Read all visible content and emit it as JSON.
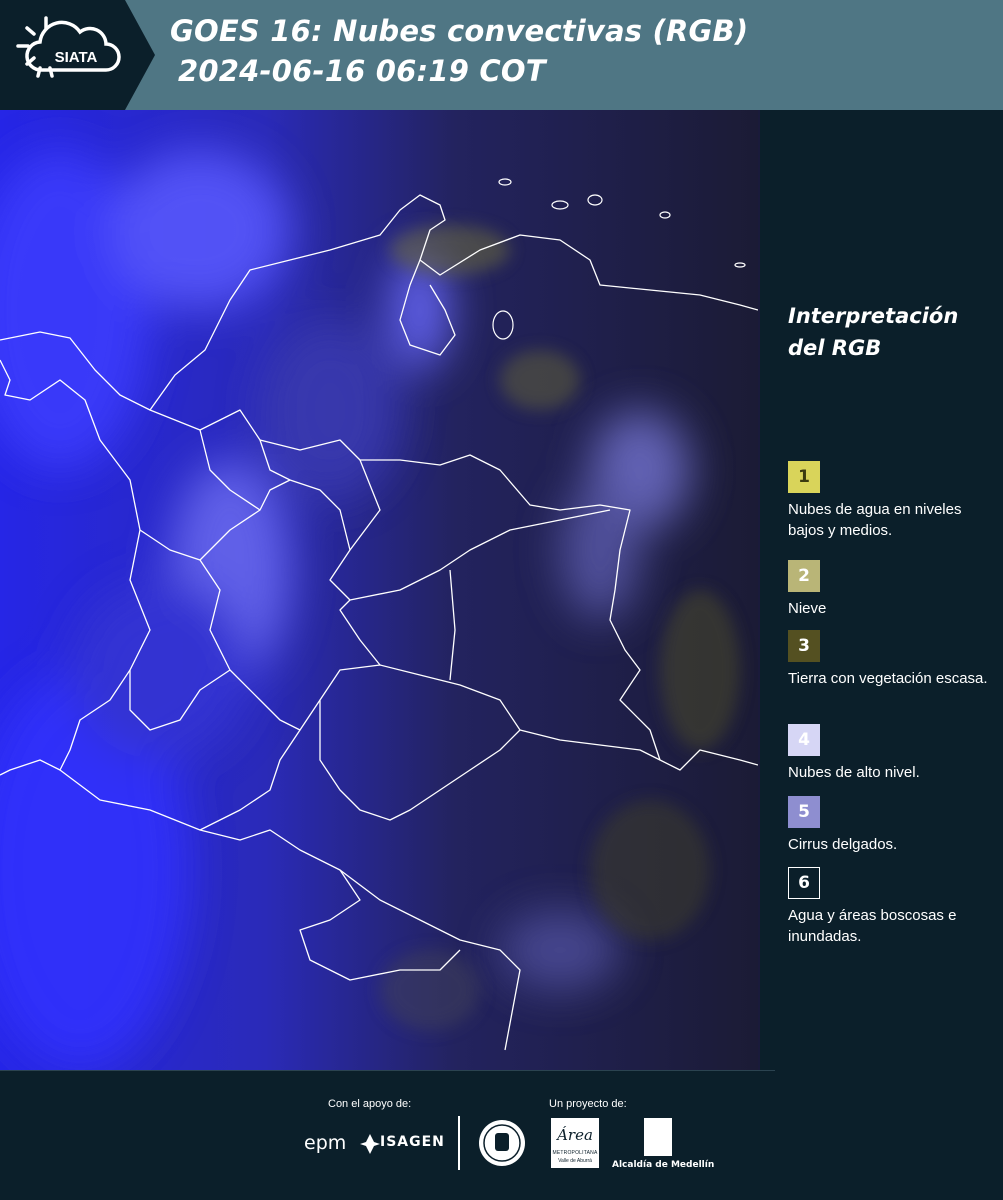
{
  "header": {
    "brand": "SIATA",
    "title_line1": "GOES 16: Nubes convectivas (RGB)",
    "title_line2": "2024-06-16 06:19 COT",
    "background_color": "#4f7684",
    "logo_panel_color": "#0b1f2a"
  },
  "map": {
    "icon": "satellite-map",
    "description_colors": {
      "clouds": "#3b3bff",
      "dark": "#1a1a3a"
    }
  },
  "legend": {
    "title": "Interpretación del RGB",
    "items": [
      {
        "number": "1",
        "label": "Nubes de agua en niveles bajos y medios.",
        "color": "#d9d45a",
        "text_color": "#3a3a10"
      },
      {
        "number": "2",
        "label": "Nieve",
        "color": "#b9b577",
        "text_color": "#ffffff"
      },
      {
        "number": "3",
        "label": "Tierra con vegetación escasa.",
        "color": "#545021",
        "text_color": "#ffffff"
      },
      {
        "number": "4",
        "label": "Nubes de alto nivel.",
        "color": "#d6d6f5",
        "text_color": "#ffffff"
      },
      {
        "number": "5",
        "label": "Cirrus delgados.",
        "color": "#8e8ed0",
        "text_color": "#ffffff"
      },
      {
        "number": "6",
        "label": "Agua y áreas boscosas e inundadas.",
        "color": "#0b1f2a",
        "text_color": "#ffffff"
      }
    ]
  },
  "footer": {
    "support_label": "Con el apoyo de:",
    "project_label": "Un proyecto de:",
    "sponsor_epm": "epm",
    "sponsor_isagen": "ISAGEN",
    "area_text_1": "Área",
    "area_text_2": "METROPOLITANA",
    "area_text_3": "Valle de Aburrá",
    "alcaldia": "Alcaldía de Medellín"
  }
}
